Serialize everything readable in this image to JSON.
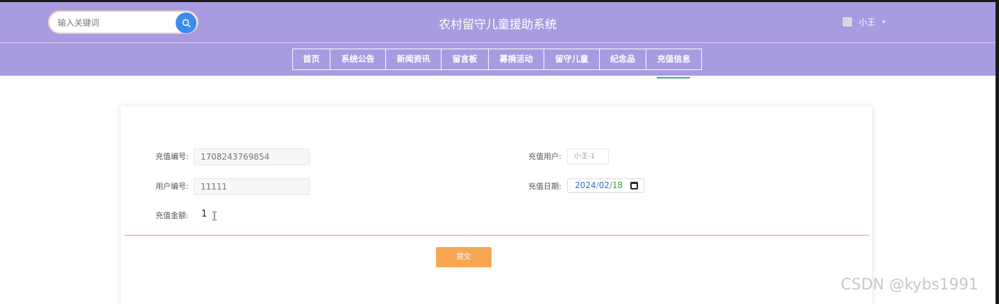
{
  "header": {
    "title": "农村留守儿童援助系统",
    "search_placeholder": "输入关键词",
    "user_name": "小王",
    "caret": "▾"
  },
  "nav": {
    "items": [
      "首页",
      "系统公告",
      "新闻资讯",
      "留言板",
      "募捐活动",
      "留守儿童",
      "纪念品",
      "充值信息"
    ],
    "active_index": 7
  },
  "form": {
    "recharge_no_label": "充值编号:",
    "recharge_no_value": "1708243769854",
    "recharge_user_label": "充值用户:",
    "recharge_user_value": "小王-1",
    "user_no_label": "用户编号:",
    "user_no_value": "11111",
    "recharge_date_label": "充值日期:",
    "date_year": "2024",
    "date_month": "02",
    "date_day": "18",
    "date_sep": "/",
    "amount_label": "充值金额:",
    "amount_value": "1",
    "submit_label": "提交"
  },
  "watermark": "CSDN @kybs1991",
  "colors": {
    "header_bg": "#a99be0",
    "search_button": "#3b8ded",
    "submit_button": "#f7a754",
    "active_indicator": "#3aaa8f"
  },
  "icons": {
    "search": "search-icon",
    "avatar": "avatar-broken-image",
    "calendar": "calendar-icon",
    "cursor": "text-cursor-icon"
  }
}
